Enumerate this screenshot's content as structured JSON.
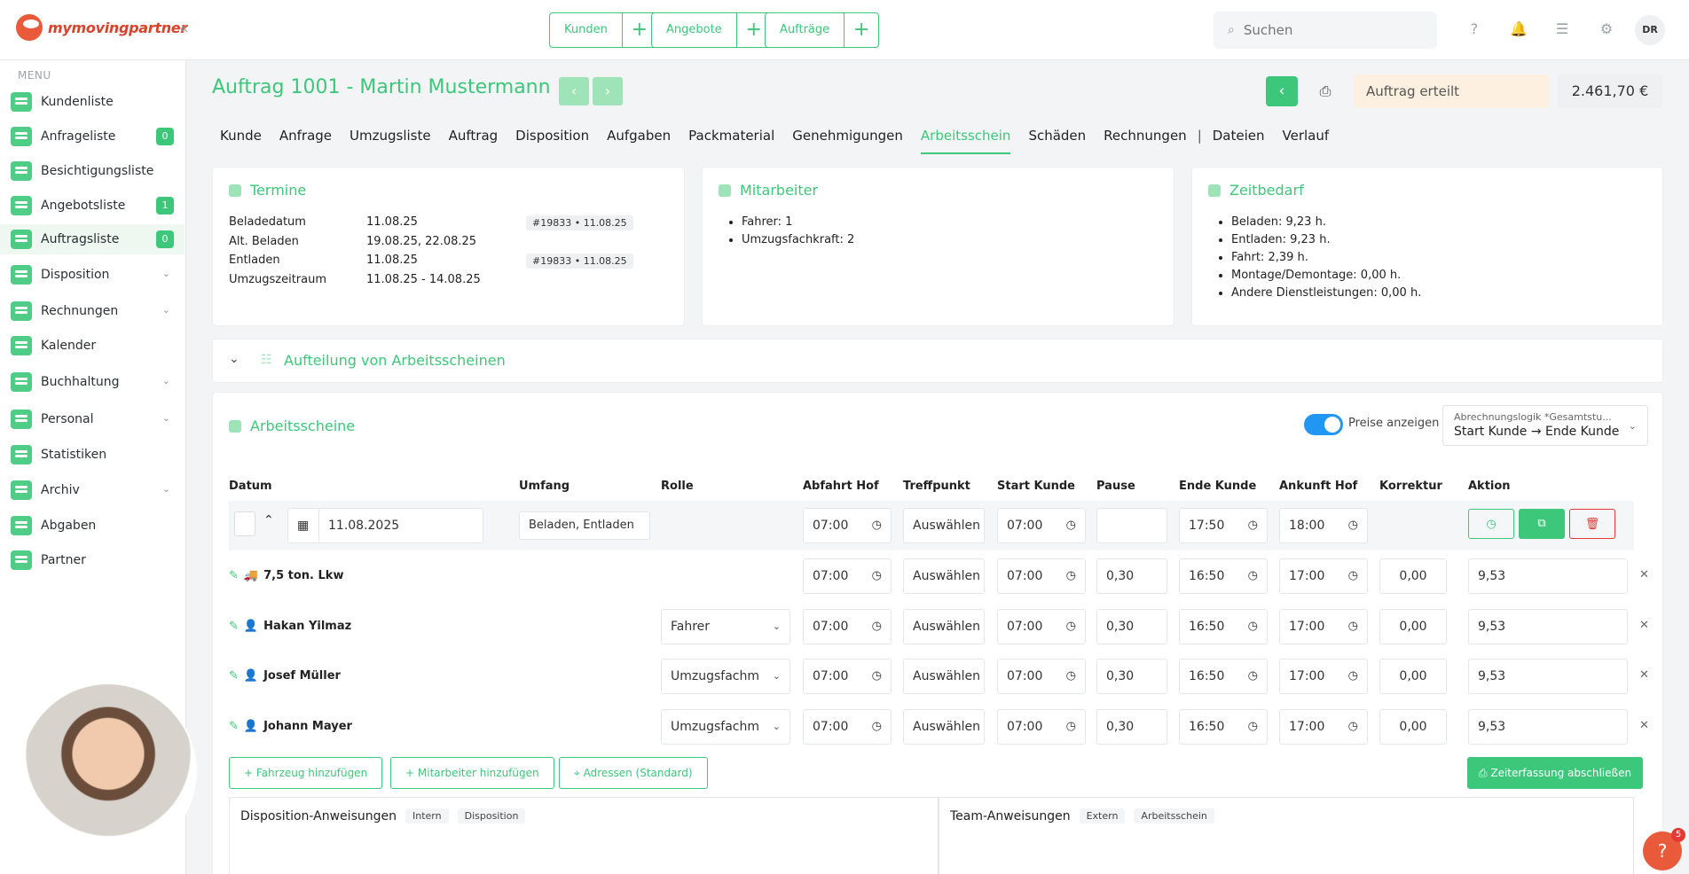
{
  "header": {
    "brand": "mymovingpartner",
    "quick_links": [
      "Kunden",
      "Angebote",
      "Aufträge"
    ],
    "search_placeholder": "Suchen",
    "avatar_initials": "DR"
  },
  "sidebar": {
    "menu_label": "MENU",
    "items": [
      {
        "label": "Kundenliste",
        "badge": ""
      },
      {
        "label": "Anfrageliste",
        "badge": "0"
      },
      {
        "label": "Besichtigungsliste",
        "badge": ""
      },
      {
        "label": "Angebotsliste",
        "badge": "1"
      },
      {
        "label": "Auftragsliste",
        "badge": "0"
      },
      {
        "label": "Disposition",
        "badge": ""
      },
      {
        "label": "Rechnungen",
        "badge": ""
      },
      {
        "label": "Kalender",
        "badge": ""
      },
      {
        "label": "Buchhaltung",
        "badge": ""
      },
      {
        "label": "Personal",
        "badge": ""
      },
      {
        "label": "Statistiken",
        "badge": ""
      },
      {
        "label": "Archiv",
        "badge": ""
      },
      {
        "label": "Abgaben",
        "badge": ""
      },
      {
        "label": "Partner",
        "badge": ""
      }
    ]
  },
  "order": {
    "title": "Auftrag 1001 - Martin Mustermann",
    "status": "Auftrag erteilt",
    "price": "2.461,70 €"
  },
  "tabs": [
    "Kunde",
    "Anfrage",
    "Umzugsliste",
    "Auftrag",
    "Disposition",
    "Aufgaben",
    "Packmaterial",
    "Genehmigungen",
    "Arbeitsschein",
    "Schäden",
    "Rechnungen",
    "Dateien",
    "Verlauf"
  ],
  "termine": {
    "title": "Termine",
    "rows": [
      {
        "label": "Beladedatum",
        "value": "11.08.25",
        "tag": "#19833 • 11.08.25"
      },
      {
        "label": "Alt. Beladen",
        "value": "19.08.25, 22.08.25",
        "tag": ""
      },
      {
        "label": "Entladen",
        "value": "11.08.25",
        "tag": "#19833 • 11.08.25"
      },
      {
        "label": "Umzugszeitraum",
        "value": "11.08.25 - 14.08.25",
        "tag": ""
      }
    ]
  },
  "mitarbeiter": {
    "title": "Mitarbeiter",
    "items": [
      "Fahrer: 1",
      "Umzugsfachkraft: 2"
    ]
  },
  "zeitbedarf": {
    "title": "Zeitbedarf",
    "items": [
      "Beladen: 9,23 h.",
      "Entladen: 9,23 h.",
      "Fahrt: 2,39 h.",
      "Montage/Demontage: 0,00 h.",
      "Andere Dienstleistungen: 0,00 h."
    ]
  },
  "split_title": "Aufteilung von Arbeitsscheinen",
  "worksheets": {
    "title": "Arbeitsscheine",
    "toggle_label": "Preise anzeigen",
    "billing_label": "Abrechnungslogik *Gesamtstu...",
    "billing_value": "Start Kunde → Ende Kunde",
    "columns": [
      "Datum",
      "Umfang",
      "Rolle",
      "Abfahrt Hof",
      "Treffpunkt",
      "Start Kunde",
      "Pause",
      "Ende Kunde",
      "Ankunft Hof",
      "Korrektur",
      "Aktion"
    ],
    "main_row": {
      "date": "11.08.2025",
      "scope": "Beladen, Entladen",
      "abfahrt": "07:00",
      "treffpunkt": "Auswählen",
      "start": "07:00",
      "pause": "",
      "ende": "17:50",
      "ankunft": "18:00"
    },
    "rows": [
      {
        "name": "7,5 ton. Lkw",
        "rolle": "",
        "abfahrt": "07:00",
        "treffpunkt": "Auswählen",
        "start": "07:00",
        "pause": "0,30",
        "ende": "16:50",
        "ankunft": "17:00",
        "korrektur": "0,00",
        "total": "9,53"
      },
      {
        "name": "Hakan Yilmaz",
        "rolle": "Fahrer",
        "abfahrt": "07:00",
        "treffpunkt": "Auswählen",
        "start": "07:00",
        "pause": "0,30",
        "ende": "16:50",
        "ankunft": "17:00",
        "korrektur": "0,00",
        "total": "9,53"
      },
      {
        "name": "Josef Müller",
        "rolle": "Umzugsfachm",
        "abfahrt": "07:00",
        "treffpunkt": "Auswählen",
        "start": "07:00",
        "pause": "0,30",
        "ende": "16:50",
        "ankunft": "17:00",
        "korrektur": "0,00",
        "total": "9,53"
      },
      {
        "name": "Johann Mayer",
        "rolle": "Umzugsfachm",
        "abfahrt": "07:00",
        "treffpunkt": "Auswählen",
        "start": "07:00",
        "pause": "0,30",
        "ende": "16:50",
        "ankunft": "17:00",
        "korrektur": "0,00",
        "total": "9,53"
      }
    ],
    "add_vehicle": "Fahrzeug hinzufügen",
    "add_employee": "Mitarbeiter hinzufügen",
    "addresses": "Adressen (Standard)",
    "close_time": "Zeiterfassung abschließen",
    "disp_title": "Disposition-Anweisungen",
    "disp_chips": [
      "Intern",
      "Disposition"
    ],
    "team_title": "Team-Anweisungen",
    "team_chips": [
      "Extern",
      "Arbeitsschein"
    ]
  },
  "help_count": "5",
  "colors": {
    "accent": "#3cc77a",
    "status_bg": "#fdf0e0",
    "toggle": "#2196f3",
    "danger": "#e53935"
  }
}
